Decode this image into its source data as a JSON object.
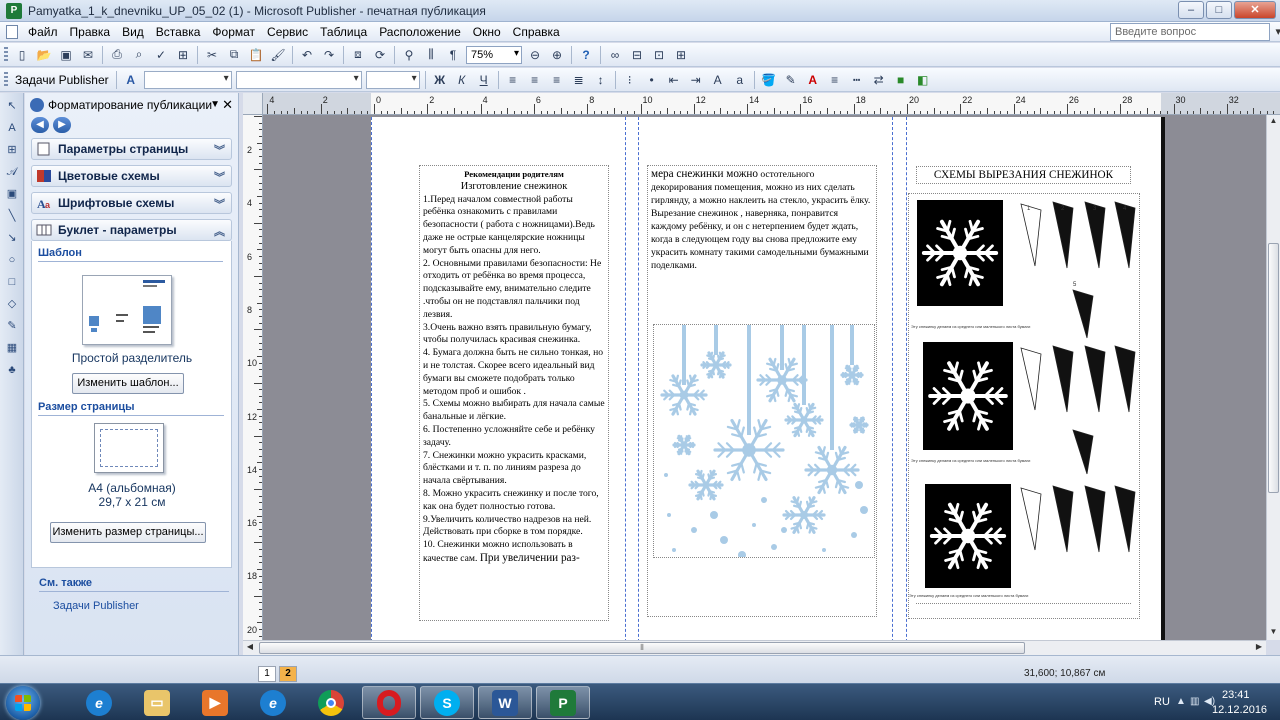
{
  "window": {
    "title": "Pamyatka_1_k_dnevniku_UP_05_02 (1) - Microsoft Publisher - печатная публикация",
    "min": "–",
    "max": "□",
    "close": "✕"
  },
  "menu": {
    "items": [
      "Файл",
      "Правка",
      "Вид",
      "Вставка",
      "Формат",
      "Сервис",
      "Таблица",
      "Расположение",
      "Окно",
      "Справка"
    ],
    "help_placeholder": "Введите вопрос"
  },
  "toolbar": {
    "zoom": "75%",
    "tasks_label": "Задачи Publisher"
  },
  "taskpane": {
    "title": "Форматирование публикации",
    "sections": [
      {
        "label": "Параметры страницы"
      },
      {
        "label": "Цветовые схемы"
      },
      {
        "label": "Шрифтовые схемы"
      },
      {
        "label": "Буклет - параметры"
      }
    ],
    "template_heading": "Шаблон",
    "template_name": "Простой разделитель",
    "change_template": "Изменить шаблон...",
    "page_size_heading": "Размер страницы",
    "page_size_name": "A4 (альбомная)",
    "page_size_dims": "29,7 x 21 см",
    "change_page_size": "Изменить размер страницы...",
    "see_also": "См. также",
    "see_also_link": "Задачи Publisher"
  },
  "ruler": {
    "h_numbers": [
      "4",
      "2",
      "0",
      "2",
      "4",
      "6",
      "8",
      "10",
      "12",
      "14",
      "16",
      "18",
      "20",
      "22",
      "24",
      "26",
      "28",
      "30",
      "32"
    ],
    "v_numbers": [
      "2",
      "4",
      "6",
      "8",
      "10",
      "12",
      "14",
      "16",
      "18",
      "20"
    ]
  },
  "document": {
    "col1": {
      "heading": "Рекомендации родителям",
      "subheading": "Изготовление снежинок",
      "paragraphs": [
        "1.Перед началом совместной работы ребёнка ознакомить с правилами безопасности ( работа с ножницами).Ведь даже не острые канцелярские ножницы могут быть опасны для него.",
        "2. Основными правилами безопасности: Не отходить от ребёнка во время процесса, подсказывайте ему, внимательно следите .чтобы он не подставлял пальчики под лезвия.",
        "3.Очень важно взять правильную бумагу, чтобы получилась красивая снежинка.",
        "4. Бумага должна быть не сильно тонкая, но и не толстая. Скорее всего идеальный вид бумаги вы сможете подобрать только методом проб и ошибок .",
        "5. Схемы можно выбирать для начала самые банальные и лёгкие.",
        "6. Постепенно усложняйте себе и ребёнку задачу.",
        "7. Снежинки можно украсить красками, блёстками и т. п. по линиям разреза до начала свёртывания.",
        "8. Можно украсить снежинку и после того, как она будет полностью готова.",
        "9.Увеличить количество надрезов на ней. Действовать при сборке в том порядке.",
        "10. Снежинки можно использовать в качестве сам."
      ],
      "tail": "При увеличении раз-"
    },
    "col2": {
      "lead": "мера снежинки можно",
      "p1": "остотельного декорирования помещения, можно из них сделать гирлянду, а можно наклеить на стекло, украсить ёлку.",
      "p2": "Вырезание снежинок , наверняка, понравится каждому ребёнку, и он с нетерпением будет ждать, когда в следующем году вы снова предложите ему украсить комнату такими самодельными бумажными поделками."
    },
    "col3": {
      "title": "СХЕМЫ ВЫРЕЗАНИЯ СНЕЖИНОК",
      "caption": "Эту снежинку делаем из среднего или маленького листа бумаги",
      "step_numbers": [
        "1",
        "2",
        "3",
        "4",
        "5"
      ]
    }
  },
  "statusbar": {
    "pages": [
      "1",
      "2"
    ],
    "coords": "31,600; 10,867 см"
  },
  "taskbar": {
    "lang": "RU",
    "time": "23:41",
    "date": "12.12.2016"
  },
  "colors": {
    "snowflake_blue": "#a9cbe6",
    "page_tab_active": "#f4b24a",
    "taskpane_link": "#1c4ea0"
  },
  "icons": [
    "windows-start-icon",
    "ie-icon",
    "explorer-icon",
    "media-player-icon",
    "chrome-icon",
    "opera-icon",
    "skype-icon",
    "word-icon",
    "publisher-icon"
  ]
}
